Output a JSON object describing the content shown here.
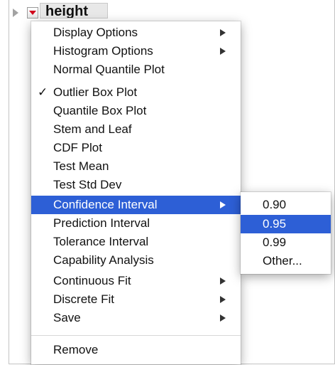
{
  "header": {
    "title": "height"
  },
  "menu": {
    "items": [
      {
        "label": "Display Options",
        "submenu": true
      },
      {
        "label": "Histogram Options",
        "submenu": true
      },
      {
        "label": "Normal Quantile Plot"
      },
      {
        "label": "Outlier Box Plot",
        "checked": true,
        "check_mark": "✓"
      },
      {
        "label": "Quantile Box Plot"
      },
      {
        "label": "Stem and Leaf"
      },
      {
        "label": "CDF Plot"
      },
      {
        "label": "Test Mean"
      },
      {
        "label": "Test Std Dev"
      },
      {
        "label": "Confidence Interval",
        "submenu": true,
        "highlighted": true
      },
      {
        "label": "Prediction Interval"
      },
      {
        "label": "Tolerance Interval"
      },
      {
        "label": "Capability Analysis"
      },
      {
        "label": "Continuous Fit",
        "submenu": true
      },
      {
        "label": "Discrete Fit",
        "submenu": true
      },
      {
        "label": "Save",
        "submenu": true
      },
      {
        "label": "Remove"
      }
    ]
  },
  "submenu": {
    "items": [
      {
        "label": "0.90"
      },
      {
        "label": "0.95",
        "highlighted": true
      },
      {
        "label": "0.99"
      },
      {
        "label": "Other..."
      }
    ]
  },
  "colors": {
    "highlight": "#2d5fd6",
    "red_triangle": "#d0021b"
  }
}
